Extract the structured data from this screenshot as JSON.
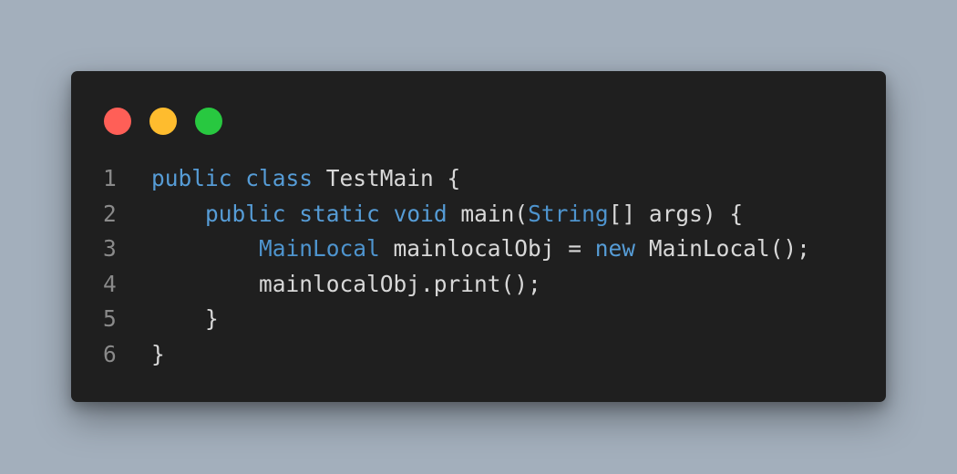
{
  "window": {
    "controls": [
      {
        "name": "close",
        "color": "#ff5f57"
      },
      {
        "name": "minimize",
        "color": "#febc2e"
      },
      {
        "name": "maximize",
        "color": "#28c840"
      }
    ]
  },
  "colors": {
    "keyword": "#569cd6",
    "type": "#4e94ce",
    "plain": "#d8d8d8",
    "line_number": "#8a8a8a"
  },
  "code": {
    "lines": [
      {
        "number": "1",
        "tokens": [
          {
            "t": "",
            "k": "pl"
          },
          {
            "t": "public",
            "k": "kw"
          },
          {
            "t": " ",
            "k": "pl"
          },
          {
            "t": "class",
            "k": "kw"
          },
          {
            "t": " TestMain {",
            "k": "pl"
          }
        ]
      },
      {
        "number": "2",
        "tokens": [
          {
            "t": "    ",
            "k": "pl"
          },
          {
            "t": "public",
            "k": "kw"
          },
          {
            "t": " ",
            "k": "pl"
          },
          {
            "t": "static",
            "k": "kw"
          },
          {
            "t": " ",
            "k": "pl"
          },
          {
            "t": "void",
            "k": "kw"
          },
          {
            "t": " main(",
            "k": "pl"
          },
          {
            "t": "String",
            "k": "ty"
          },
          {
            "t": "[] args) {",
            "k": "pl"
          }
        ]
      },
      {
        "number": "3",
        "tokens": [
          {
            "t": "        ",
            "k": "pl"
          },
          {
            "t": "MainLocal",
            "k": "ty"
          },
          {
            "t": " mainlocalObj = ",
            "k": "pl"
          },
          {
            "t": "new",
            "k": "kw"
          },
          {
            "t": " MainLocal();",
            "k": "pl"
          }
        ]
      },
      {
        "number": "4",
        "tokens": [
          {
            "t": "        mainlocalObj.print();",
            "k": "pl"
          }
        ]
      },
      {
        "number": "5",
        "tokens": [
          {
            "t": "    }",
            "k": "pl"
          }
        ]
      },
      {
        "number": "6",
        "tokens": [
          {
            "t": "}",
            "k": "pl"
          }
        ]
      }
    ]
  }
}
